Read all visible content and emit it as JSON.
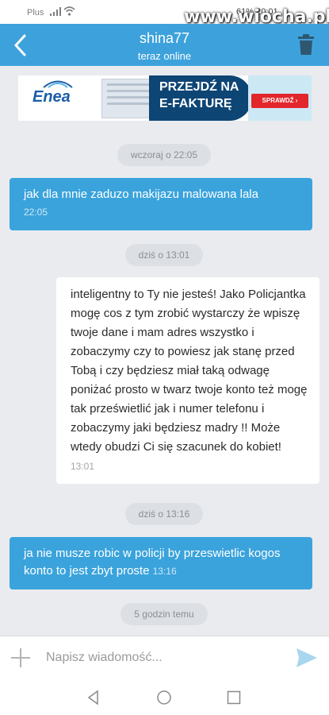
{
  "status_bar": {
    "carrier": "Plus",
    "right_text": "61% 20:01"
  },
  "watermark": "www.wiocha.pl",
  "header": {
    "contact_name": "shina77",
    "presence": "teraz online"
  },
  "ad": {
    "brand": "Enea",
    "cta_line1": "PRZEJDŹ NA",
    "cta_line2": "E-FAKTURĘ",
    "button": "SPRAWDŹ ›"
  },
  "messages": [
    {
      "type": "date",
      "text": "wczoraj o 22:05"
    },
    {
      "type": "out",
      "text": "jak dla mnie zaduzo makijazu malowana lala",
      "time": "22:05"
    },
    {
      "type": "date",
      "text": "dziś o 13:01"
    },
    {
      "type": "in",
      "text": "inteligentny to Ty nie jesteś! Jako Policjantka mogę cos z tym zrobić wystarczy że wpiszę twoje dane i mam adres wszystko i zobaczymy czy to powiesz jak stanę przed Tobą i czy będziesz miał taką odwagę poniżać prosto w twarz twoje konto też mogę tak prześwietlić jak i numer telefonu i zobaczymy jaki będziesz madry !! Może wtedy obudzi Ci się szacunek do kobiet!",
      "time": "13:01"
    },
    {
      "type": "date",
      "text": "dziś o 13:16"
    },
    {
      "type": "out",
      "text": "ja nie musze robic w policji by przeswietlic kogos konto to jest zbyt proste",
      "time": "13:16"
    },
    {
      "type": "date",
      "text": "5 godzin temu"
    }
  ],
  "composer": {
    "placeholder": "Napisz wiadomość..."
  },
  "colors": {
    "accent": "#3da2dc",
    "outgoing_bubble": "#3aa3dc",
    "incoming_bubble": "#ffffff",
    "background": "#e9ebef"
  }
}
